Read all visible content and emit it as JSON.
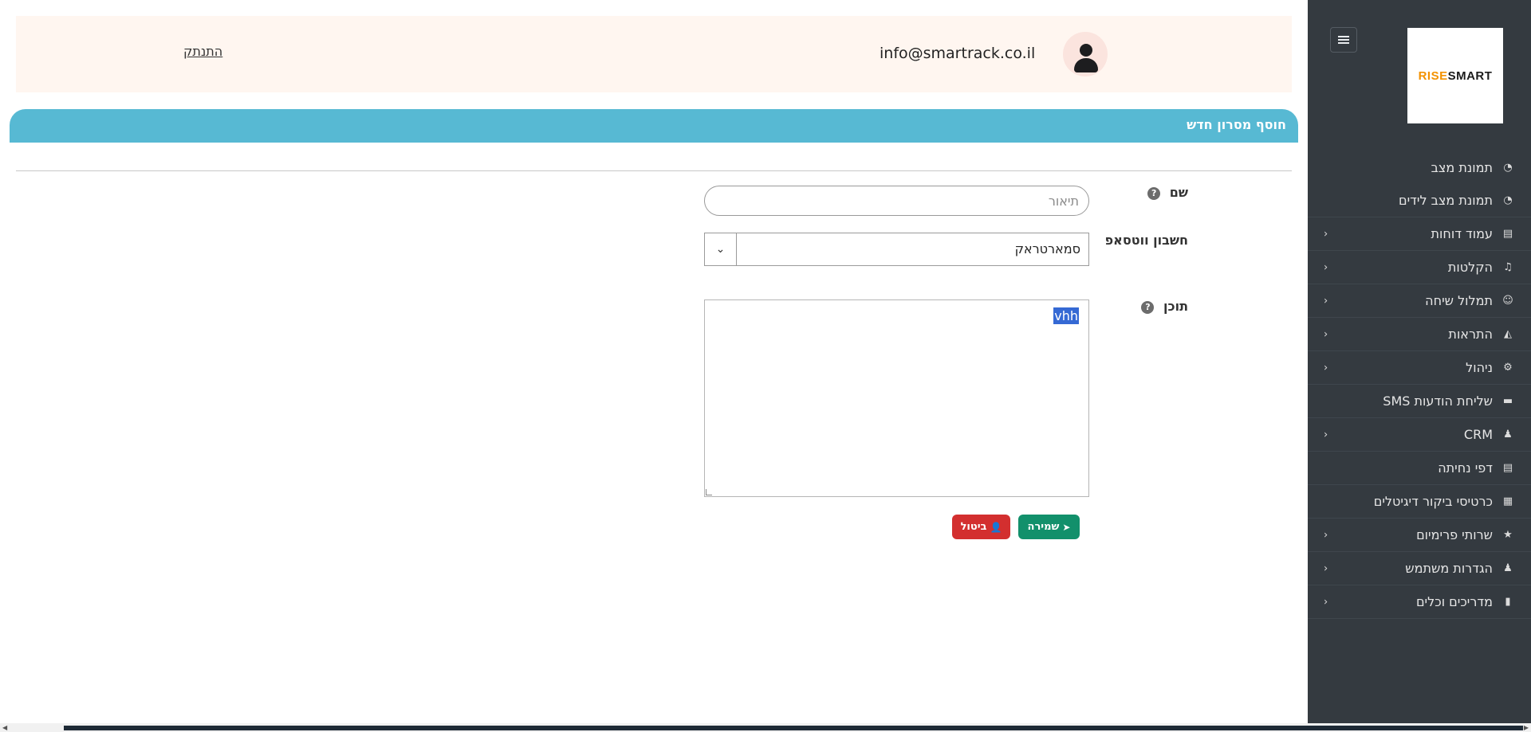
{
  "sidebar": {
    "logo": {
      "part1": "SMART",
      "part2": "RISE"
    },
    "items": [
      {
        "label": "תמונת מצב",
        "icon": "gauge-icon",
        "glyph": "◔",
        "has_submenu": false
      },
      {
        "label": "תמונת מצב לידים",
        "icon": "gauge-icon",
        "glyph": "◔",
        "has_submenu": false
      },
      {
        "label": "עמוד דוחות",
        "icon": "report-icon",
        "glyph": "▤",
        "has_submenu": true
      },
      {
        "label": "הקלטות",
        "icon": "music-note-icon",
        "glyph": "♫",
        "has_submenu": true
      },
      {
        "label": "תמלול שיחה",
        "icon": "smile-icon",
        "glyph": "☺",
        "has_submenu": true
      },
      {
        "label": "התראות",
        "icon": "megaphone-icon",
        "glyph": "◭",
        "has_submenu": true
      },
      {
        "label": "ניהול",
        "icon": "gear-icon",
        "glyph": "⚙",
        "has_submenu": true
      },
      {
        "label": "שליחת הודעות SMS",
        "icon": "message-icon",
        "glyph": "▬",
        "has_submenu": false
      },
      {
        "label": "CRM",
        "icon": "users-icon",
        "glyph": "♟",
        "has_submenu": true
      },
      {
        "label": "דפי נחיתה",
        "icon": "page-icon",
        "glyph": "▤",
        "has_submenu": false
      },
      {
        "label": "כרטיסי ביקור דיגיטלים",
        "icon": "card-icon",
        "glyph": "▦",
        "has_submenu": false
      },
      {
        "label": "שרותי פרימיום",
        "icon": "star-icon",
        "glyph": "★",
        "has_submenu": true
      },
      {
        "label": "הגדרות משתמש",
        "icon": "user-icon",
        "glyph": "♟",
        "has_submenu": true
      },
      {
        "label": "מדריכים וכלים",
        "icon": "book-icon",
        "glyph": "▮",
        "has_submenu": true
      }
    ]
  },
  "header": {
    "logout_label": "התנתק",
    "email": "info@smartrack.co.il"
  },
  "card": {
    "title": "חוסף מסרון חדש"
  },
  "form": {
    "name": {
      "label": "שם",
      "placeholder": "תיאור",
      "value": ""
    },
    "whatsapp": {
      "label": "חשבון ווטסאפ",
      "value": "סמארטראק"
    },
    "content": {
      "label": "תוכן",
      "value": "vhh"
    },
    "help_glyph": "?",
    "save_label": "שמירה",
    "cancel_label": "ביטול"
  },
  "colors": {
    "sidebar_bg": "#343a40",
    "card_header": "#57b9d3",
    "save_button": "#12906b",
    "cancel_button": "#d32f2f",
    "userbar_bg": "#fff6f0"
  }
}
